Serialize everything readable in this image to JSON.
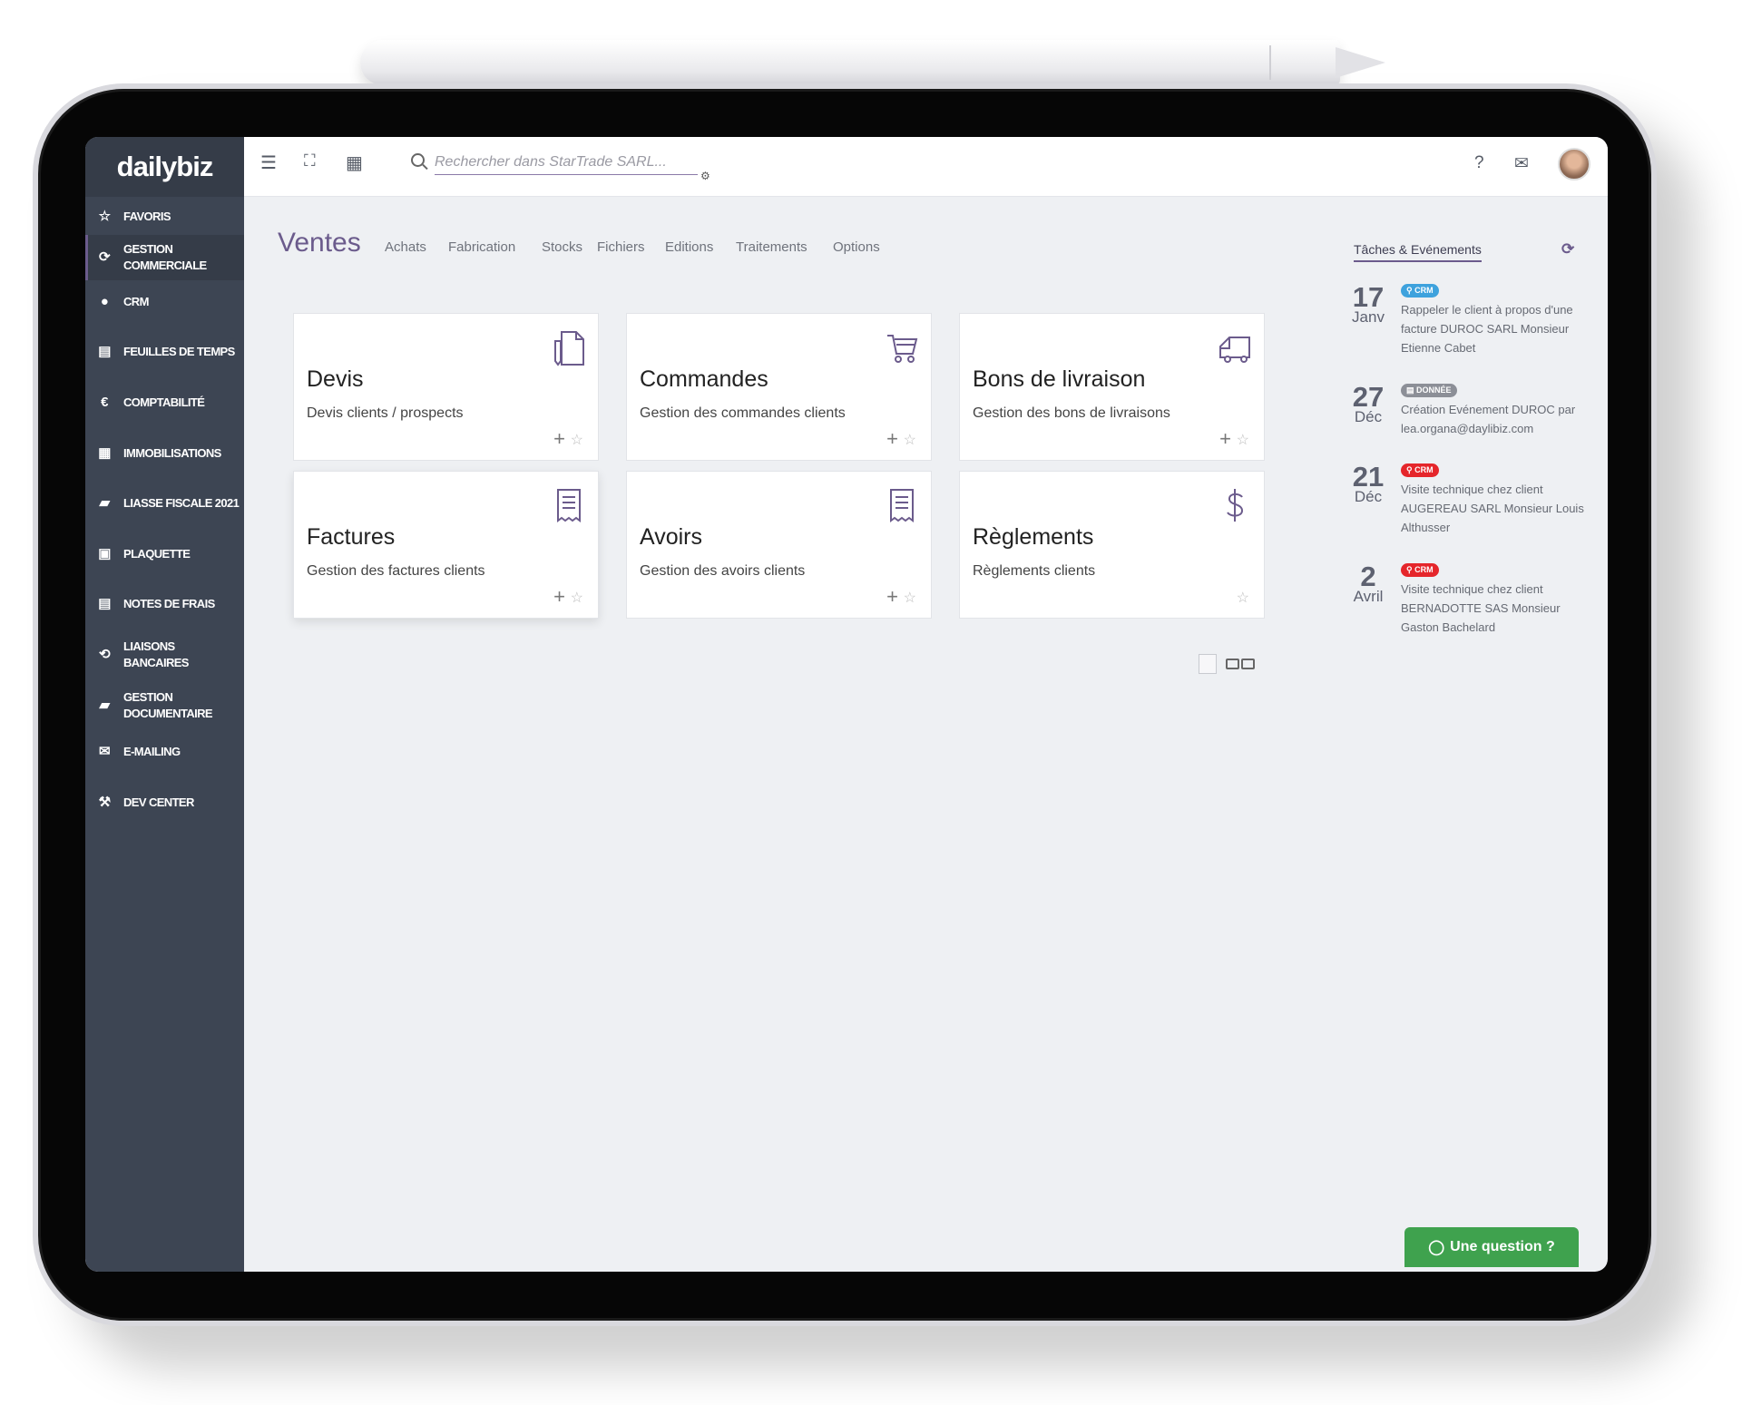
{
  "app": {
    "logo": "dailybiz"
  },
  "sidebar": {
    "items": [
      {
        "label": "FAVORIS",
        "icon": "star-icon",
        "glyph": "☆"
      },
      {
        "label": "GESTION COMMERCIALE",
        "icon": "sync-icon",
        "glyph": "⟳"
      },
      {
        "label": "CRM",
        "icon": "users-icon",
        "glyph": "👥"
      },
      {
        "label": "FEUILLES DE TEMPS",
        "icon": "timesheet-icon",
        "glyph": "▤"
      },
      {
        "label": "COMPTABILITÉ",
        "icon": "euro-icon",
        "glyph": "€"
      },
      {
        "label": "IMMOBILISATIONS",
        "icon": "calendar-euro-icon",
        "glyph": "▦"
      },
      {
        "label": "LIASSE FISCALE 2021",
        "icon": "folder-open-icon",
        "glyph": "▰"
      },
      {
        "label": "PLAQUETTE",
        "icon": "booklet-icon",
        "glyph": "▣"
      },
      {
        "label": "NOTES DE FRAIS",
        "icon": "receipt-icon",
        "glyph": "▤"
      },
      {
        "label": "LIAISONS BANCAIRES",
        "icon": "bank-sync-icon",
        "glyph": "⟲"
      },
      {
        "label": "GESTION DOCUMENTAIRE",
        "icon": "folder-icon",
        "glyph": "▰"
      },
      {
        "label": "E-MAILING",
        "icon": "mail-settings-icon",
        "glyph": "✉"
      },
      {
        "label": "DEV CENTER",
        "icon": "wrench-icon",
        "glyph": "🔧"
      }
    ]
  },
  "topbar": {
    "search_placeholder": "Rechercher dans StarTrade SARL...",
    "help": "?",
    "mail": "✉"
  },
  "main": {
    "module": "Ventes",
    "tabs": [
      "Achats",
      "Fabrication",
      "Stocks",
      "Fichiers",
      "Editions",
      "Traitements",
      "Options"
    ],
    "cards": [
      {
        "title": "Devis",
        "subtitle": "Devis clients / prospects",
        "icon": "document-pen-icon",
        "plus": "+",
        "star": "☆"
      },
      {
        "title": "Commandes",
        "subtitle": "Gestion des commandes clients",
        "icon": "cart-icon",
        "plus": "+",
        "star": "☆"
      },
      {
        "title": "Bons de livraison",
        "subtitle": "Gestion des bons de livraisons",
        "icon": "truck-icon",
        "plus": "+",
        "star": "☆"
      },
      {
        "title": "Factures",
        "subtitle": "Gestion des factures clients",
        "icon": "invoice-icon",
        "plus": "+",
        "star": "☆"
      },
      {
        "title": "Avoirs",
        "subtitle": "Gestion des avoirs clients",
        "icon": "credit-note-icon",
        "plus": "+",
        "star": "☆"
      },
      {
        "title": "Règlements",
        "subtitle": "Règlements clients",
        "icon": "dollar-icon",
        "star": "☆"
      }
    ]
  },
  "panel": {
    "title": "Tâches & Evénements",
    "events": [
      {
        "day": "17",
        "month": "Janv",
        "badge": "⚲ CRM",
        "badge_type": "crm-blue",
        "text": "Rappeler le client à propos d'une facture DUROC SARL Monsieur Etienne Cabet"
      },
      {
        "day": "27",
        "month": "Déc",
        "badge": "▤ DONNÉE",
        "badge_type": "donnee",
        "text": "Création Evénement DUROC par lea.organa@daylibiz.com"
      },
      {
        "day": "21",
        "month": "Déc",
        "badge": "⚲ CRM",
        "badge_type": "crm-red",
        "text": "Visite technique chez client AUGEREAU SARL Monsieur Louis Althusser"
      },
      {
        "day": "2",
        "month": "Avril",
        "badge": "⚲ CRM",
        "badge_type": "crm-red",
        "text": "Visite technique chez client BERNADOTTE SAS Monsieur Gaston Bachelard"
      }
    ]
  },
  "chat": {
    "label": "Une question ?"
  },
  "colors": {
    "accent": "#6b5b8c",
    "sidebar": "#3d4553",
    "chat": "#3fa24e",
    "crm": "#e5262b"
  }
}
